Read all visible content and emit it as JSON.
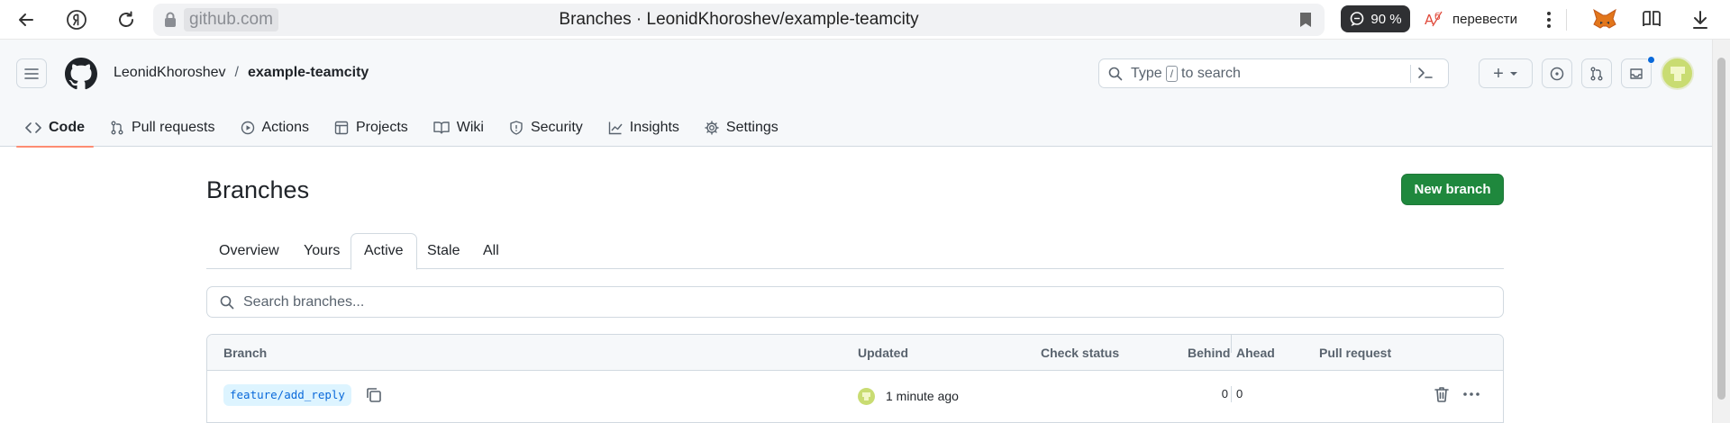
{
  "browser": {
    "host": "github.com",
    "tab_title": "Branches · LeonidKhoroshev/example-teamcity",
    "reviews_badge": "90 %",
    "translate_label": "перевести"
  },
  "header": {
    "owner": "LeonidKhoroshev",
    "separator": "/",
    "repo": "example-teamcity",
    "search_before": "Type",
    "search_key": "/",
    "search_after": "to search",
    "create_label": "+"
  },
  "repo_nav": {
    "items": [
      {
        "label": "Code",
        "icon": "code-icon"
      },
      {
        "label": "Pull requests",
        "icon": "git-pull-request-icon"
      },
      {
        "label": "Actions",
        "icon": "play-icon"
      },
      {
        "label": "Projects",
        "icon": "table-icon"
      },
      {
        "label": "Wiki",
        "icon": "book-icon"
      },
      {
        "label": "Security",
        "icon": "shield-icon"
      },
      {
        "label": "Insights",
        "icon": "graph-icon"
      },
      {
        "label": "Settings",
        "icon": "gear-icon"
      }
    ],
    "active": "Code"
  },
  "page": {
    "title": "Branches",
    "new_branch_label": "New branch",
    "tabs": [
      "Overview",
      "Yours",
      "Active",
      "Stale",
      "All"
    ],
    "active_tab": "Active",
    "search_placeholder": "Search branches..."
  },
  "table": {
    "columns": {
      "branch": "Branch",
      "updated": "Updated",
      "check_status": "Check status",
      "behind": "Behind",
      "ahead": "Ahead",
      "pull_request": "Pull request"
    },
    "rows": [
      {
        "branch": "feature/add_reply",
        "updated": "1 minute ago",
        "check_status": "",
        "behind": "0",
        "ahead": "0",
        "pull_request": ""
      }
    ]
  },
  "colors": {
    "primary_button": "#1f883d",
    "active_tab_underline": "#fd8c73",
    "branch_chip_bg": "#ddf4ff",
    "branch_chip_text": "#0969da",
    "notification_dot": "#0969da",
    "avatar": "#c9dc72"
  }
}
